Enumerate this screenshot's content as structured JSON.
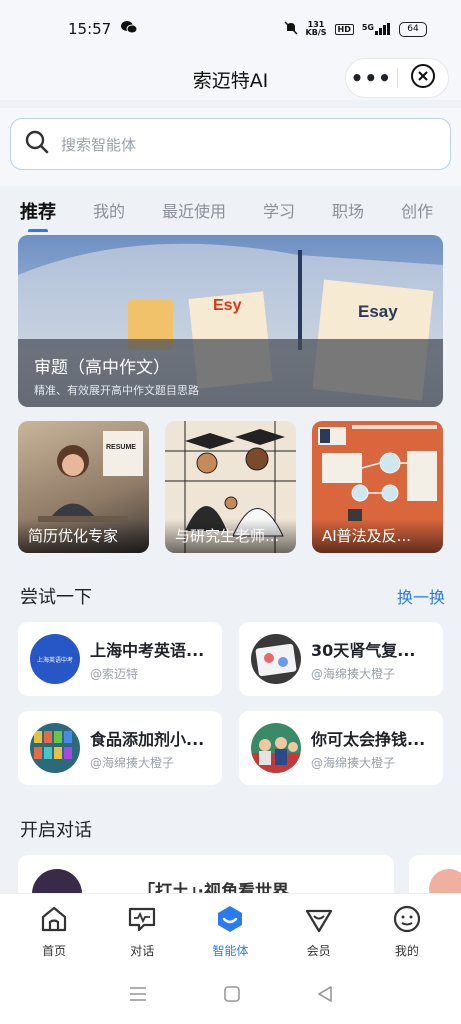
{
  "status": {
    "time": "15:57",
    "net_speed_top": "131",
    "net_speed_unit": "KB/S",
    "hd": "HD",
    "network": "5G",
    "battery": "64"
  },
  "header": {
    "title": "索迈特AI",
    "more_label": "•••"
  },
  "search": {
    "placeholder": "搜索智能体"
  },
  "tabs": [
    "推荐",
    "我的",
    "最近使用",
    "学习",
    "职场",
    "创作"
  ],
  "banner": {
    "title": "审题（高中作文）",
    "subtitle": "精准、有效展开高中作文题目思路",
    "paper_text_1": "Esy",
    "paper_text_2": "Esay"
  },
  "feature_cards": [
    {
      "label": "简历优化专家",
      "sign": "RESUME"
    },
    {
      "label": "与研究生老师..."
    },
    {
      "label": "AI普法及反..."
    }
  ],
  "try_section": {
    "title": "尝试一下",
    "refresh_label": "换一换"
  },
  "agents": [
    {
      "name": "上海中考英语...",
      "author": "@索迈特",
      "avatar_text": "上海英语中考"
    },
    {
      "name": "30天肾气复...",
      "author": "@海绵揍大橙子"
    },
    {
      "name": "食品添加剂小...",
      "author": "@海绵揍大橙子"
    },
    {
      "name": "你可太会挣钱...",
      "author": "@海绵揍大橙子"
    }
  ],
  "chat_section": {
    "title": "开启对话",
    "first_card_text": "「打土」·视角看世界"
  },
  "bottom_nav": [
    {
      "label": "首页",
      "icon": "home-icon"
    },
    {
      "label": "对话",
      "icon": "chat-icon"
    },
    {
      "label": "智能体",
      "icon": "agent-icon"
    },
    {
      "label": "会员",
      "icon": "vip-icon"
    },
    {
      "label": "我的",
      "icon": "profile-icon"
    }
  ],
  "colors": {
    "accent": "#2b7bf0",
    "background": "#eef1f6"
  }
}
